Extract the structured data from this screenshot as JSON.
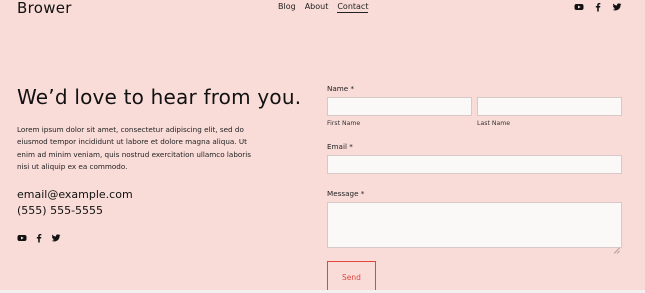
{
  "header": {
    "brand": "Brower",
    "nav": [
      {
        "label": "Blog"
      },
      {
        "label": "About"
      },
      {
        "label": "Contact",
        "active": true
      }
    ],
    "social_icons": [
      "youtube-icon",
      "facebook-icon",
      "twitter-icon"
    ]
  },
  "intro": {
    "headline": "We’d love to hear from you.",
    "body": "Lorem ipsum dolor sit amet, consectetur adipiscing elit, sed do eiusmod tempor incididunt ut labore et dolore magna aliqua. Ut enim ad minim veniam, quis nostrud exercitation ullamco laboris nisi ut aliquip ex ea commodo.",
    "email": "email@example.com",
    "phone": "(555) 555-5555",
    "social_icons": [
      "youtube-icon",
      "facebook-icon",
      "twitter-icon"
    ]
  },
  "form": {
    "name_label": "Name *",
    "first_name_label": "First Name",
    "last_name_label": "Last Name",
    "first_name_value": "",
    "last_name_value": "",
    "email_label": "Email *",
    "email_value": "",
    "message_label": "Message *",
    "message_value": "",
    "send_label": "Send"
  },
  "colors": {
    "background": "#f9dcd8",
    "accent": "#e0473f",
    "input_bg": "#fbf9f8"
  }
}
